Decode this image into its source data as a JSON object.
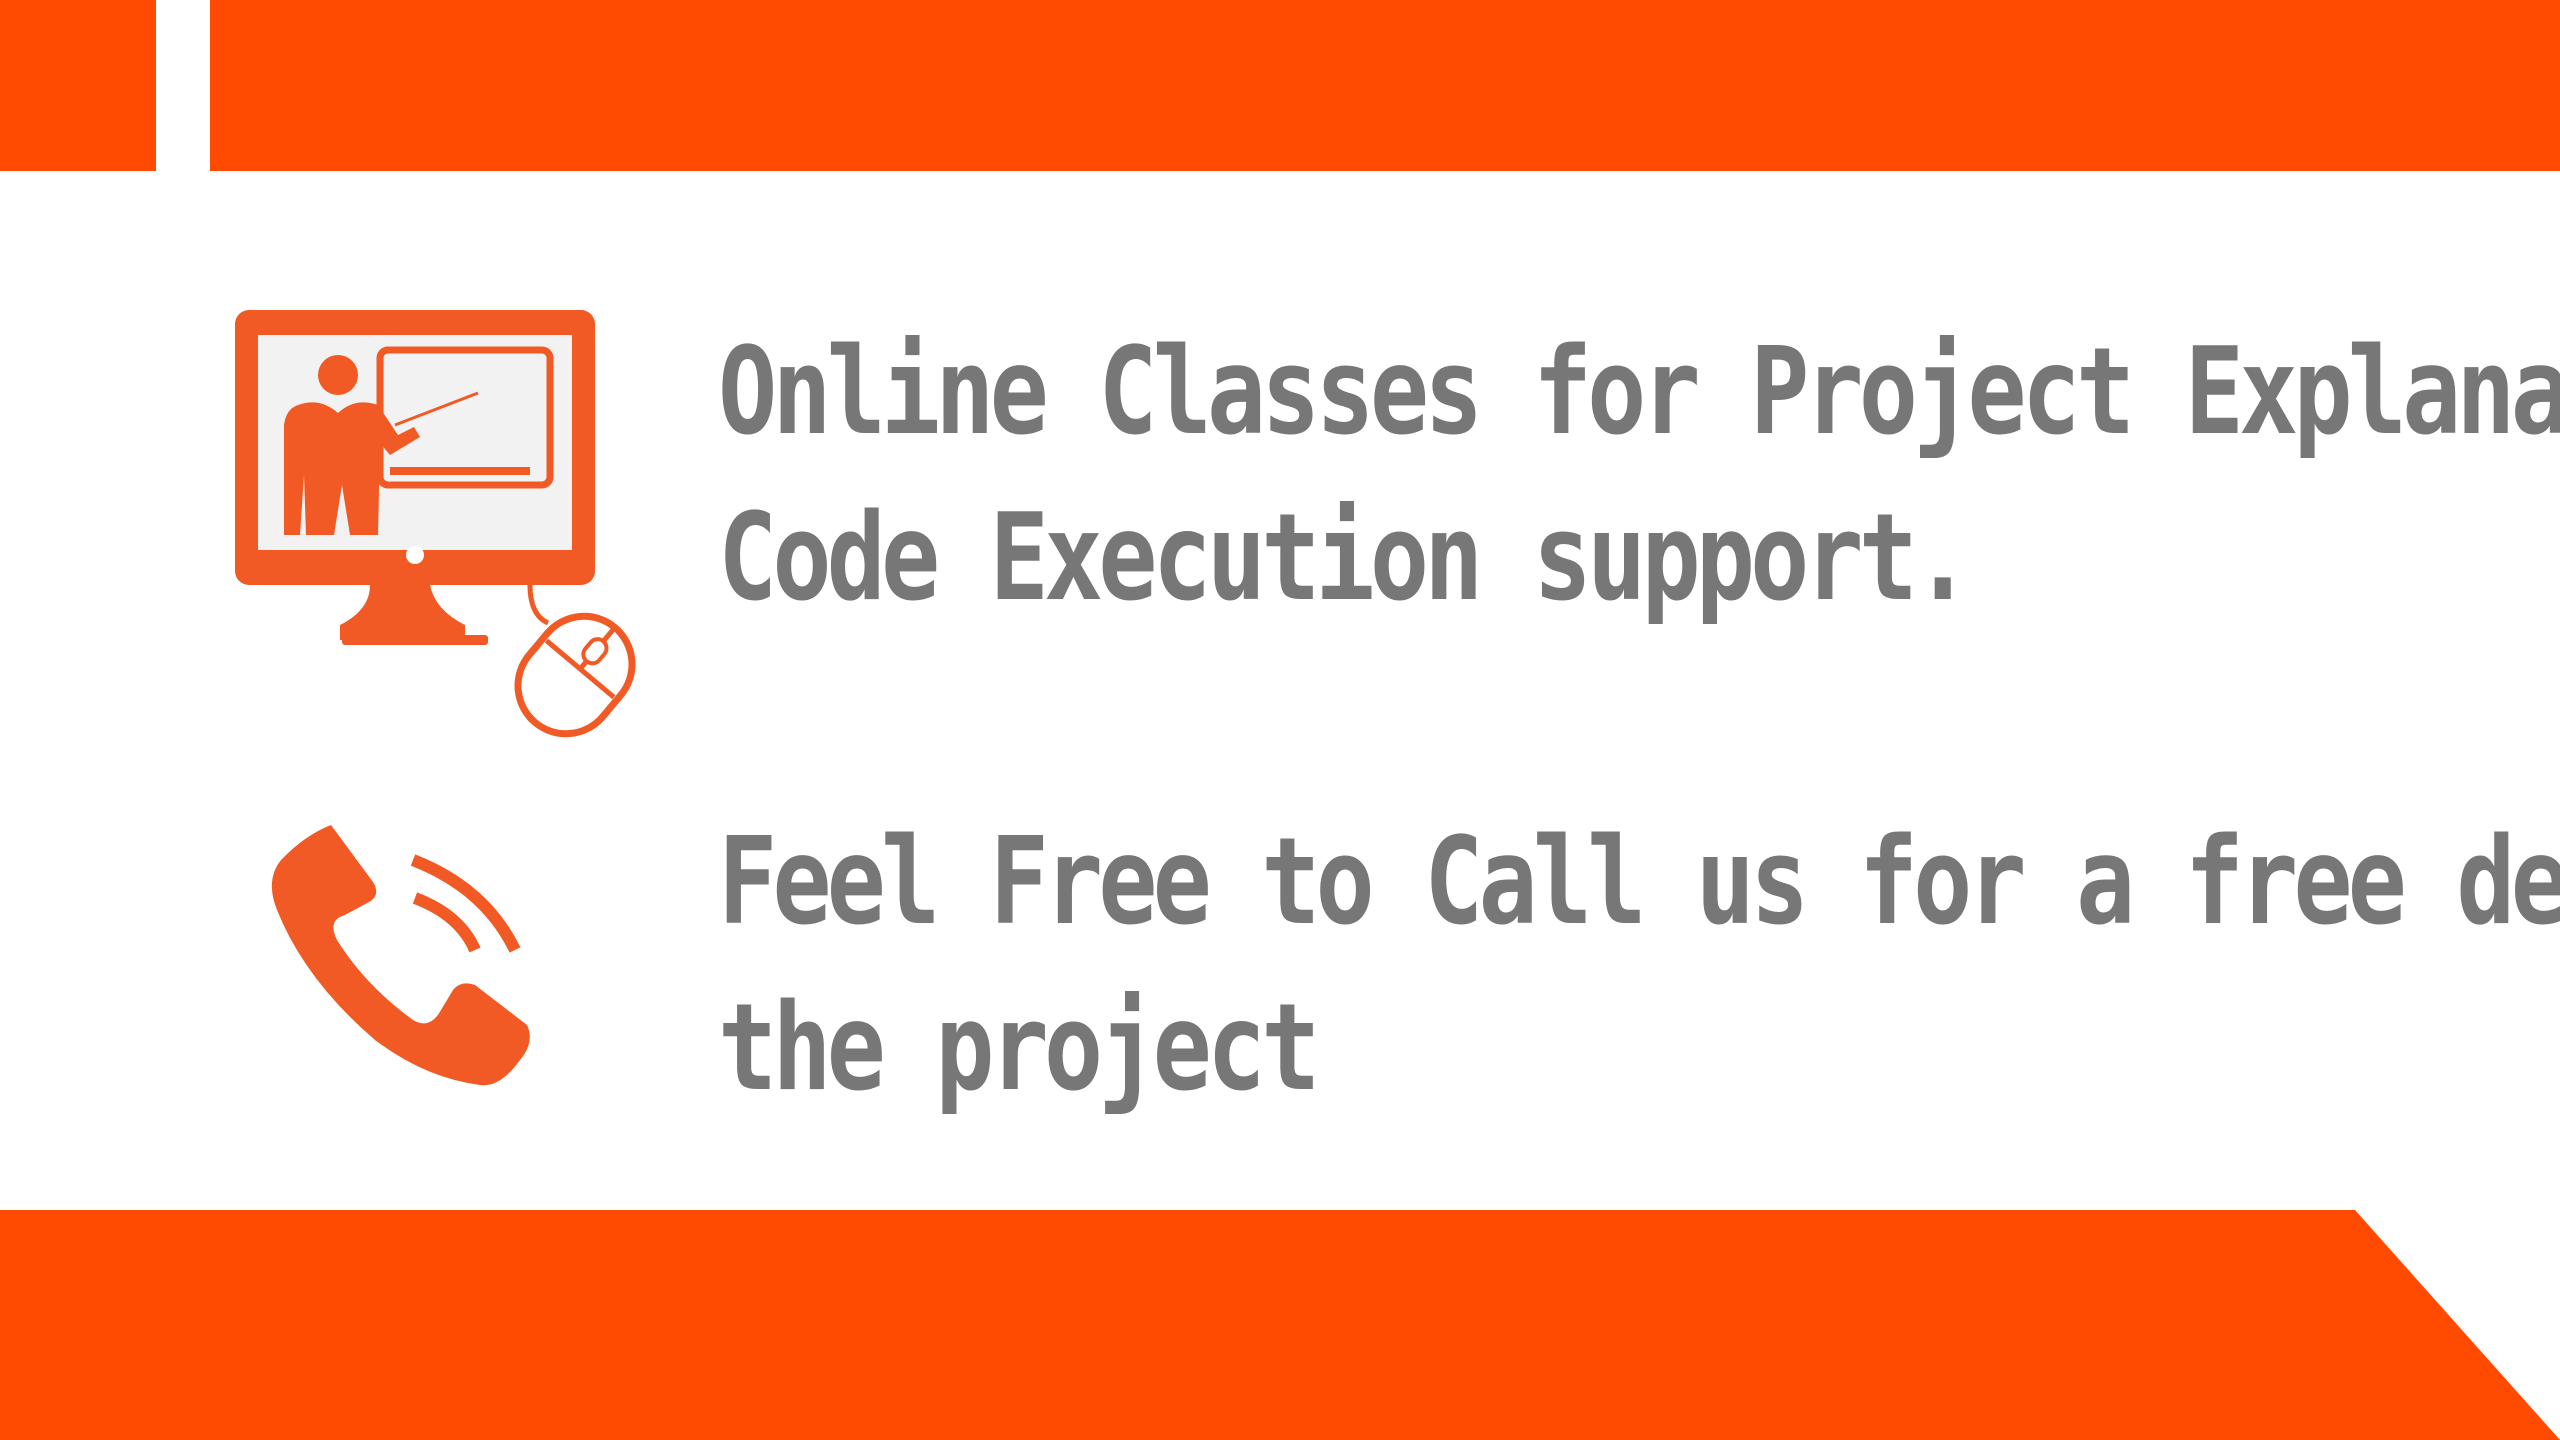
{
  "colors": {
    "accent": "#ff4a00",
    "icon_orange": "#f15a24",
    "text": "#777777",
    "background": "#ffffff"
  },
  "icons": {
    "computer": "computer-teacher-icon",
    "mouse": "mouse-icon",
    "phone": "phone-call-icon"
  },
  "content": {
    "item1": {
      "line1": "Online Classes for Project Explanation and",
      "line2": "Code Execution support."
    },
    "item2": {
      "line1": "Feel Free to Call us for a free demo of",
      "line2": "the project"
    }
  }
}
